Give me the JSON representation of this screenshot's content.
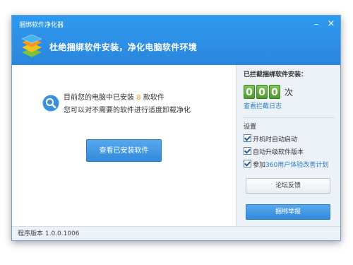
{
  "window": {
    "title": "捆绑软件净化器",
    "minimize_icon": "minimize-icon",
    "close_icon": "close-icon"
  },
  "header": {
    "logo_icon": "layered-cube-logo-icon",
    "slogan": "杜绝捆绑软件安装，净化电脑软件环境"
  },
  "main": {
    "info_icon": "magnifier-icon",
    "line1_prefix": "目前您的电脑中已安装",
    "installed_count": "8",
    "line1_suffix": "款软件",
    "line2": "您可以对不需要的软件进行适度卸载净化",
    "view_installed_button": "查看已安装软件"
  },
  "stats": {
    "blocked_label": "已拦截捆绑软件安装：",
    "digits": [
      "0",
      "0",
      "0"
    ],
    "unit": "次",
    "log_link": "查看拦截日志"
  },
  "settings": {
    "label": "设置",
    "options": [
      {
        "text": "开机时自动启动",
        "checked": true
      },
      {
        "text": "自动升级软件版本",
        "checked": true
      },
      {
        "prefix": "参加",
        "link": "360用户体验改善计划",
        "checked": true
      }
    ]
  },
  "buttons": {
    "forum": "论坛反馈",
    "report": "捆绑举报"
  },
  "footer": {
    "version": "程序版本 1.0.0.1006"
  },
  "colors": {
    "title_bar": "#2a8ee6",
    "accent_blue": "#3389dc",
    "counter_green": "#5aa636",
    "count_highlight": "#f39a1e",
    "link": "#2a7ec8",
    "panel_bg": "#ecf2f8"
  }
}
